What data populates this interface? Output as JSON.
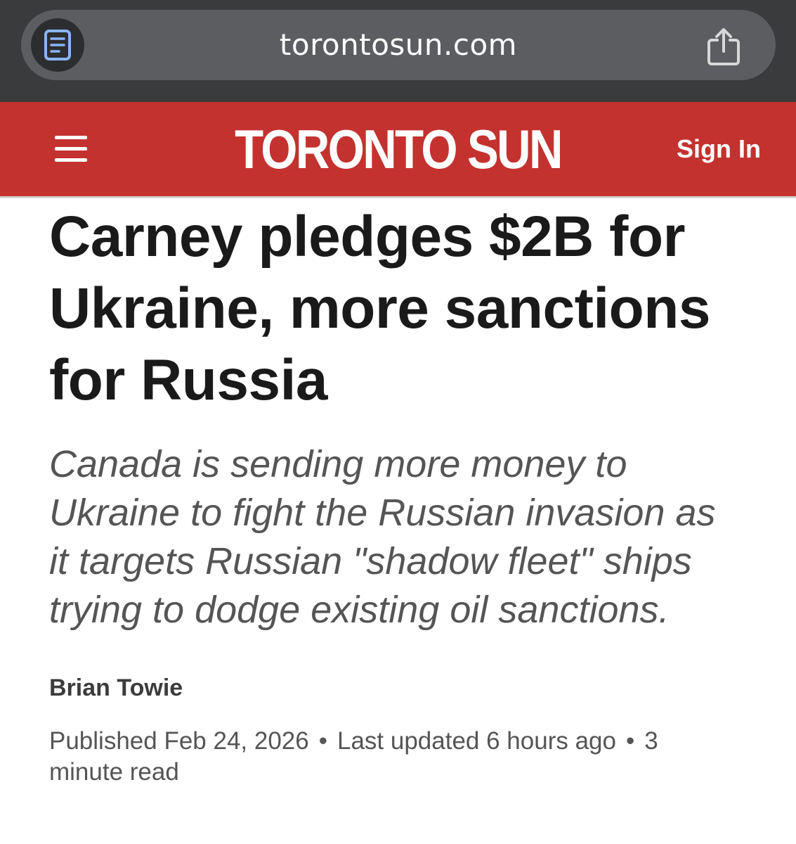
{
  "browser": {
    "url": "torontosun.com",
    "reader_icon": "reader-view-icon",
    "share_icon": "share-icon"
  },
  "header": {
    "menu_icon": "hamburger-menu-icon",
    "logo_part1": "TORONTO",
    "logo_part2": "SUN",
    "sign_in_label": "Sign In",
    "brand_color": "#c3322f"
  },
  "article": {
    "headline": "Carney pledges $2B for Ukraine, more sanctions for Russia",
    "deck": "Canada is sending more money to Ukraine to fight the Russian invasion as it targets Russian \"shadow fleet\" ships trying to dodge existing oil sanctions.",
    "author": "Brian Towie",
    "published": "Published Feb 24, 2026",
    "separator": "•",
    "updated": "Last updated 6 hours ago",
    "read_time": "3 minute read"
  }
}
